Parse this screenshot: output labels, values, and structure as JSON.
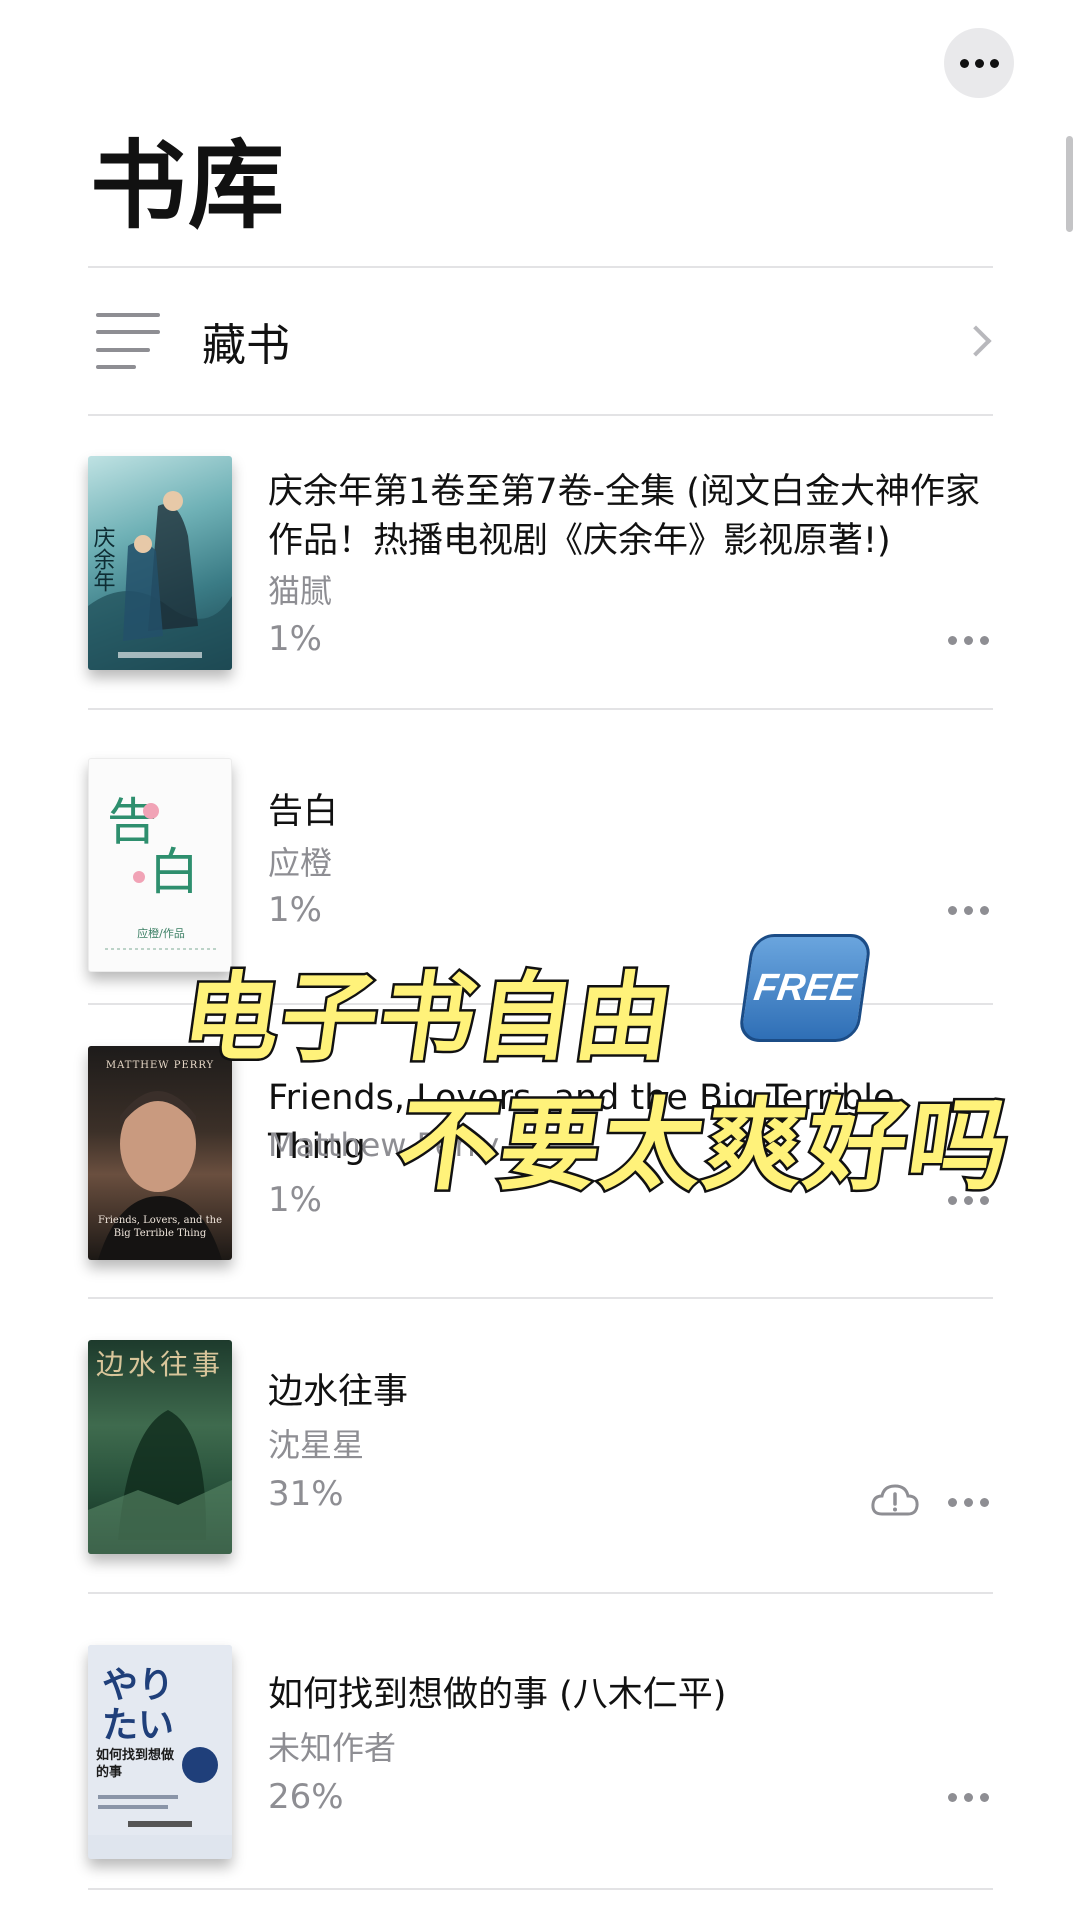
{
  "header": {
    "title": "书库"
  },
  "collection": {
    "label": "藏书"
  },
  "books": [
    {
      "title": "庆余年第1卷至第7卷-全集 (阅文白金大神作家作品！热播电视剧《庆余年》影视原著!)",
      "author": "猫腻",
      "progress": "1%",
      "cover_text": "庆余年"
    },
    {
      "title": "告白",
      "author": "应橙",
      "progress": "1%",
      "cover_text": "告白",
      "cover_subtext": "应橙/作品"
    },
    {
      "title": "Friends, Lovers, and the Big Terrible Thing",
      "author": "Matthew Perry",
      "progress": "1%",
      "cover_text": "MATTHEW PERRY",
      "cover_subtext": "Friends, Lovers, and the Big Terrible Thing"
    },
    {
      "title": "边水往事",
      "author": "沈星星",
      "progress": "31%",
      "cover_text": "边水往事",
      "download_status": "cloud-warning"
    },
    {
      "title": "如何找到想做的事 (八木仁平)",
      "author": "未知作者",
      "progress": "26%",
      "cover_text": "如何找到想做的事"
    }
  ],
  "overlay": {
    "line1": "电子书自由",
    "badge": "FREE",
    "line2": "不要太爽好吗"
  },
  "colors": {
    "overlay_text": "#fff27a",
    "secondary_text": "#8e8e93",
    "badge_blue": "#2f6fb6"
  }
}
